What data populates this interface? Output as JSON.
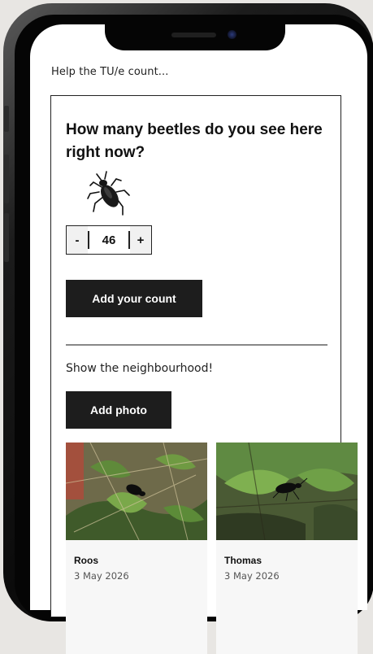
{
  "header": {
    "help_text": "Help the TU/e count..."
  },
  "counter": {
    "question": "How many beetles do you see here right now?",
    "decrement_label": "-",
    "value": "46",
    "increment_label": "+",
    "submit_label": "Add your count"
  },
  "gallery": {
    "prompt": "Show the neighbourhood!",
    "add_photo_label": "Add photo",
    "photos": [
      {
        "name": "Roos",
        "date": "3 May 2026"
      },
      {
        "name": "Thomas",
        "date": "3 May 2026"
      }
    ]
  },
  "icons": {
    "beetle": "beetle-icon"
  },
  "colors": {
    "button_bg": "#1d1d1d",
    "card_border": "#222222"
  }
}
